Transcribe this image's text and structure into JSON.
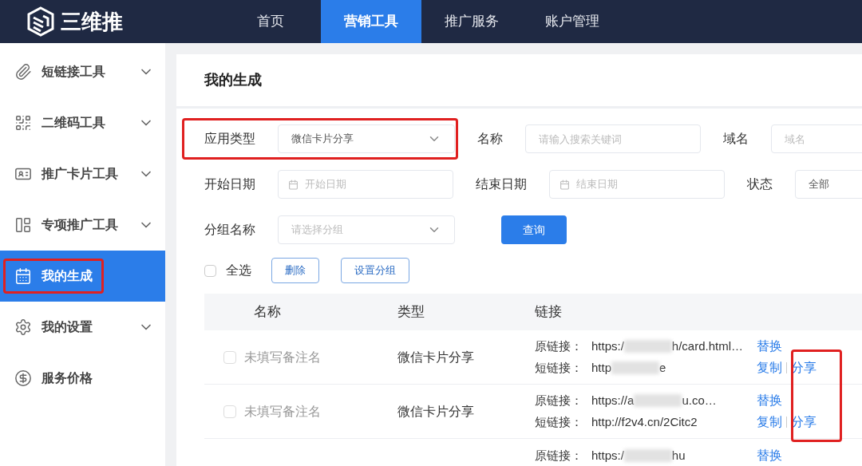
{
  "brand": {
    "name": "三维推"
  },
  "nav": [
    {
      "label": "首页",
      "selected": false
    },
    {
      "label": "营销工具",
      "selected": true
    },
    {
      "label": "推广服务",
      "selected": false
    },
    {
      "label": "账户管理",
      "selected": false
    }
  ],
  "sidebar": {
    "items": [
      {
        "label": "短链接工具",
        "selected": false,
        "expandable": true,
        "highlighted": false
      },
      {
        "label": "二维码工具",
        "selected": false,
        "expandable": true,
        "highlighted": false
      },
      {
        "label": "推广卡片工具",
        "selected": false,
        "expandable": true,
        "highlighted": false
      },
      {
        "label": "专项推广工具",
        "selected": false,
        "expandable": true,
        "highlighted": false
      },
      {
        "label": "我的生成",
        "selected": true,
        "expandable": false,
        "highlighted": true
      },
      {
        "label": "我的设置",
        "selected": false,
        "expandable": true,
        "highlighted": false
      },
      {
        "label": "服务价格",
        "selected": false,
        "expandable": false,
        "highlighted": false
      }
    ]
  },
  "page_title": "我的生成",
  "filters": [
    [
      {
        "kind": "select",
        "label": "应用类型",
        "value": "微信卡片分享",
        "highlighted": true
      },
      {
        "kind": "input",
        "label": "名称",
        "placeholder": "请输入搜索关键词"
      },
      {
        "kind": "input",
        "label": "域名",
        "placeholder": "域名"
      }
    ],
    [
      {
        "kind": "date",
        "label": "开始日期",
        "placeholder": "开始日期"
      },
      {
        "kind": "date",
        "label": "结束日期",
        "placeholder": "结束日期"
      },
      {
        "kind": "select",
        "label": "状态",
        "value": "全部"
      }
    ],
    [
      {
        "kind": "select",
        "label": "分组名称",
        "placeholder": "请选择分组"
      },
      {
        "kind": "button",
        "label": "查询"
      }
    ]
  ],
  "bulk": {
    "select_all": {
      "label": "全选",
      "checked": false
    },
    "buttons": [
      "删除",
      "设置分组"
    ]
  },
  "table": {
    "columns": [
      "名称",
      "类型",
      "链接"
    ],
    "share_highlighted": true,
    "rows": [
      {
        "checked": false,
        "name": "未填写备注名",
        "type": "微信卡片分享",
        "links": [
          {
            "label": "原链接：",
            "prefix": "https:/",
            "redacted": true,
            "suffix": "h/card.html…",
            "actions": [
              "替换"
            ]
          },
          {
            "label": "短链接：",
            "prefix": "http",
            "redacted": true,
            "suffix": "e",
            "actions": [
              "复制",
              "分享"
            ]
          }
        ]
      },
      {
        "checked": false,
        "name": "未填写备注名",
        "type": "微信卡片分享",
        "links": [
          {
            "label": "原链接：",
            "prefix": "https://a",
            "redacted": true,
            "suffix": "u.co…",
            "actions": [
              "替换"
            ]
          },
          {
            "label": "短链接：",
            "prefix": "http://f2v4.cn/2Citc2",
            "redacted": false,
            "actions": [
              "复制",
              "分享"
            ]
          }
        ]
      },
      {
        "links": [
          {
            "label": "原链接：",
            "prefix": "https:/",
            "redacted": true,
            "suffix": "hu",
            "actions": [
              "替换"
            ]
          }
        ]
      }
    ]
  }
}
